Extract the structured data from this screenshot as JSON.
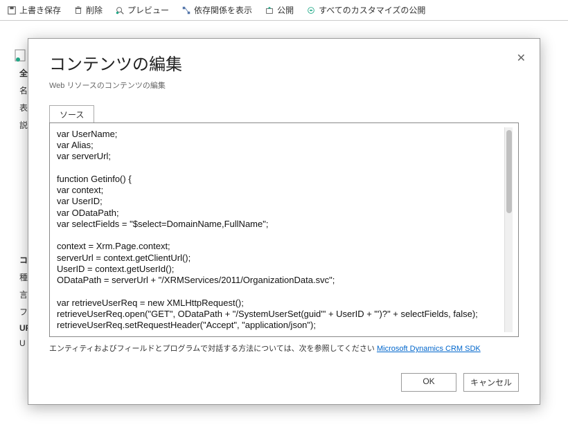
{
  "toolbar": {
    "save": "上書き保存",
    "delete": "削除",
    "preview": "プレビュー",
    "deps": "依存関係を表示",
    "publish": "公開",
    "publish_all": "すべてのカスタマイズの公開"
  },
  "side": {
    "general": "全般",
    "name": "名",
    "display": "表",
    "desc": "説",
    "comp": "コン",
    "type": "種",
    "lang": "言",
    "file": "フ",
    "url_bold": "UR",
    "url": "U"
  },
  "modal": {
    "title": "コンテンツの編集",
    "subtitle": "Web リソースのコンテンツの編集",
    "tab": "ソース",
    "code": "var UserName;\nvar Alias;\nvar serverUrl;\n\nfunction Getinfo() {\nvar context;\nvar UserID;\nvar ODataPath;\nvar selectFields = \"$select=DomainName,FullName\";\n\ncontext = Xrm.Page.context;\nserverUrl = context.getClientUrl();\nUserID = context.getUserId();\nODataPath = serverUrl + \"/XRMServices/2011/OrganizationData.svc\";\n\nvar retrieveUserReq = new XMLHttpRequest();\nretrieveUserReq.open(\"GET\", ODataPath + \"/SystemUserSet(guid'\" + UserID + \"')?\" + selectFields, false);\nretrieveUserReq.setRequestHeader(\"Accept\", \"application/json\");",
    "hint_pre": "エンティティおよびフィールドとプログラムで対話する方法については、次を参照してください ",
    "hint_link": "Microsoft Dynamics CRM SDK",
    "ok": "OK",
    "cancel": "キャンセル"
  }
}
